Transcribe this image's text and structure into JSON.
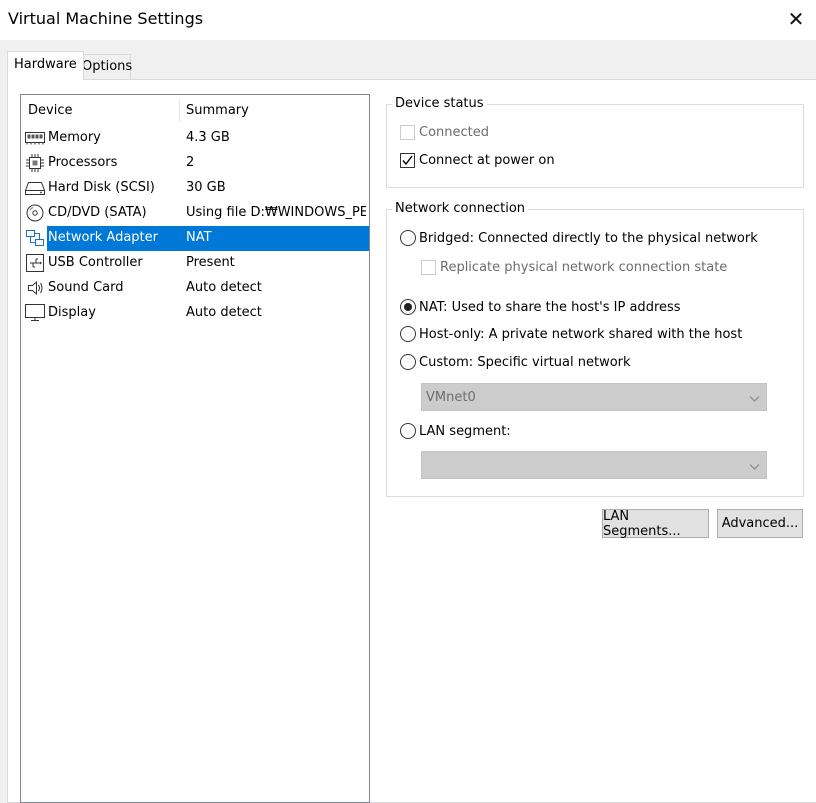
{
  "window": {
    "title": "Virtual Machine Settings",
    "close_glyph": "✕"
  },
  "tabs": [
    {
      "label": "Hardware"
    },
    {
      "label": "Options"
    }
  ],
  "device_list": {
    "headers": {
      "device": "Device",
      "summary": "Summary"
    },
    "selected_index": 4,
    "rows": [
      {
        "name": "Memory",
        "summary": "4.3 GB",
        "icon": "memory-icon"
      },
      {
        "name": "Processors",
        "summary": "2",
        "icon": "processor-icon"
      },
      {
        "name": "Hard Disk (SCSI)",
        "summary": "30 GB",
        "icon": "hard-disk-icon"
      },
      {
        "name": "CD/DVD (SATA)",
        "summary": "Using file D:₩WINDOWS_PE...",
        "icon": "cd-dvd-icon"
      },
      {
        "name": "Network Adapter",
        "summary": "NAT",
        "icon": "network-adapter-icon"
      },
      {
        "name": "USB Controller",
        "summary": "Present",
        "icon": "usb-icon"
      },
      {
        "name": "Sound Card",
        "summary": "Auto detect",
        "icon": "sound-card-icon"
      },
      {
        "name": "Display",
        "summary": "Auto detect",
        "icon": "display-icon"
      }
    ]
  },
  "device_status": {
    "title": "Device status",
    "connected": {
      "label": "Connected",
      "checked": false,
      "disabled": true
    },
    "connect_at_power_on": {
      "label": "Connect at power on",
      "checked": true,
      "disabled": false
    }
  },
  "network_connection": {
    "title": "Network connection",
    "bridged": {
      "label": "Bridged: Connected directly to the physical network",
      "selected": false
    },
    "replicate": {
      "label": "Replicate physical network connection state",
      "checked": false,
      "disabled": true
    },
    "nat": {
      "label": "NAT: Used to share the host's IP address",
      "selected": true
    },
    "host_only": {
      "label": "Host-only: A private network shared with the host",
      "selected": false
    },
    "custom": {
      "label": "Custom: Specific virtual network",
      "selected": false
    },
    "vmnet_select": {
      "value": "VMnet0",
      "disabled": true
    },
    "lan_segment": {
      "label": "LAN segment:",
      "selected": false
    },
    "lan_segment_select": {
      "value": "",
      "disabled": true
    }
  },
  "buttons": {
    "lan_segments": "LAN Segments...",
    "advanced": "Advanced..."
  }
}
